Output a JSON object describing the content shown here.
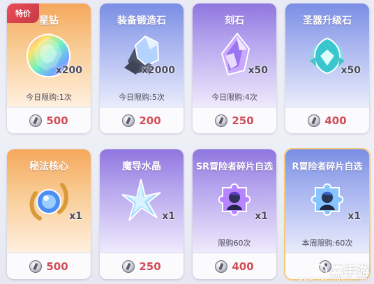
{
  "shop": {
    "promo_tag": "特价",
    "items": [
      {
        "name": "星钻",
        "qty": "x200",
        "limit": "今日限购:1次",
        "price": "500",
        "icon": "rainbow-diamond-icon",
        "bg": "gold"
      },
      {
        "name": "装备锻造石",
        "qty": "x2000",
        "limit": "今日限购:5次",
        "price": "200",
        "icon": "forging-stone-icon",
        "bg": "blue"
      },
      {
        "name": "刻石",
        "qty": "x50",
        "limit": "今日限购:4次",
        "price": "250",
        "icon": "engraving-stone-icon",
        "bg": "purple"
      },
      {
        "name": "圣器升级石",
        "qty": "x50",
        "limit": "",
        "price": "400",
        "icon": "relic-upgrade-stone-icon",
        "bg": "blue"
      },
      {
        "name": "秘法核心",
        "qty": "x1",
        "limit": "",
        "price": "500",
        "icon": "arcane-core-icon",
        "bg": "gold"
      },
      {
        "name": "魔导水晶",
        "qty": "x1",
        "limit": "",
        "price": "250",
        "icon": "magic-crystal-icon",
        "bg": "purple"
      },
      {
        "name": "SR冒险者碎片自选",
        "qty": "x1",
        "limit": "限购60次",
        "price": "400",
        "icon": "sr-fragment-icon",
        "bg": "purple"
      },
      {
        "name": "R冒险者碎片自选",
        "qty": "x1",
        "limit": "本周限购:60次",
        "price": "",
        "icon": "r-fragment-icon",
        "bg": "blue"
      }
    ]
  },
  "currency_icon": "silver-coin-icon",
  "watermark": {
    "text_cn": "嘉手游",
    "text_en": "www.jiashouyou.com"
  },
  "colors": {
    "price": "#d24e59",
    "promo_tag": "#eb4b59",
    "gold_bg": "#f6a75c",
    "blue_bg": "#7a8ee4",
    "purple_bg": "#9076df"
  }
}
